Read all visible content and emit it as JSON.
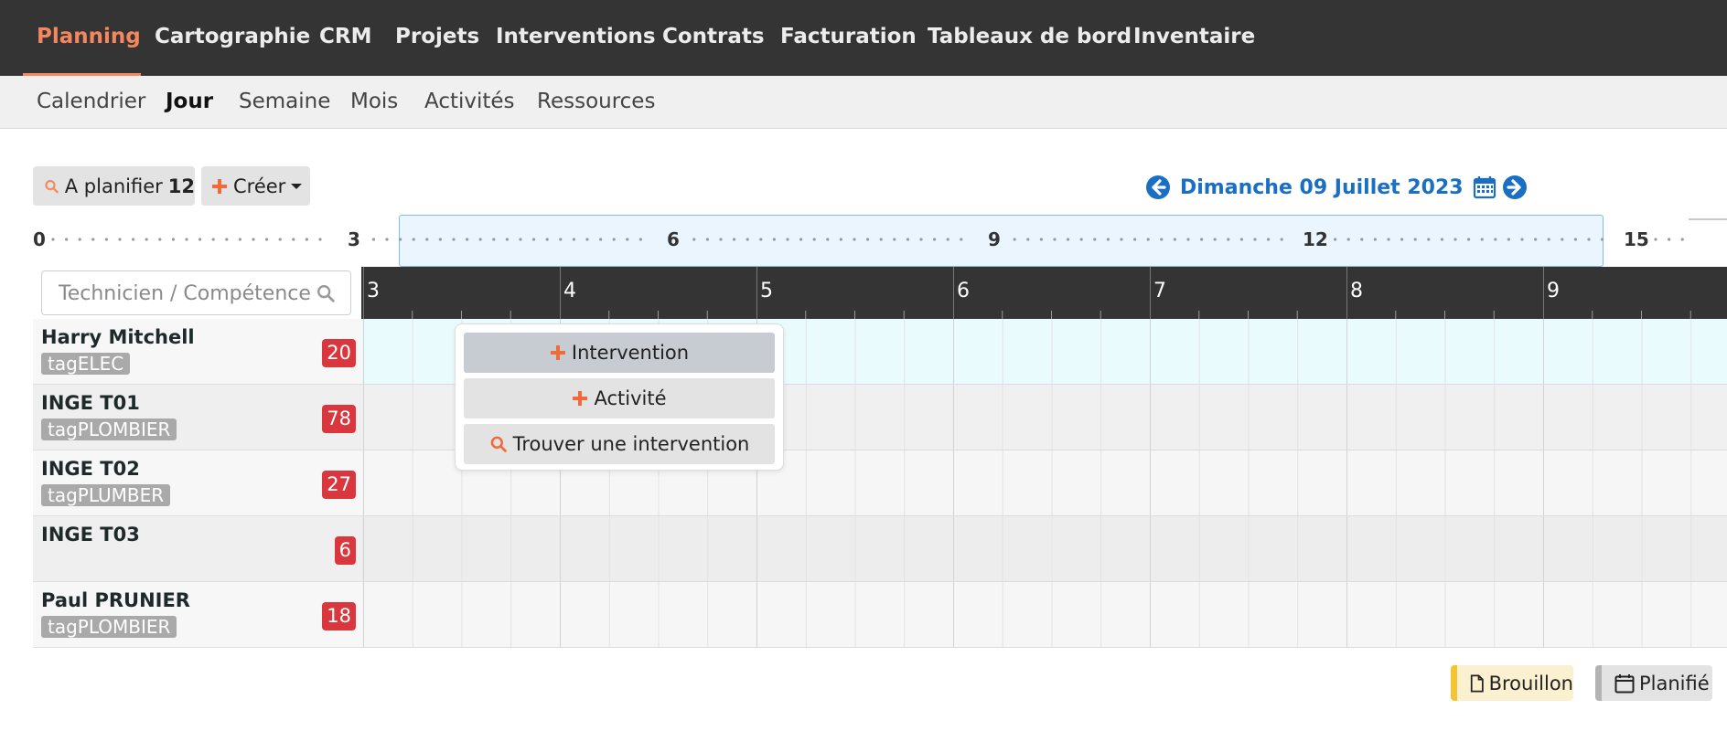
{
  "top_nav": {
    "items": [
      {
        "label": "Planning",
        "active": true
      },
      {
        "label": "Cartographie"
      },
      {
        "label": "CRM"
      },
      {
        "label": "Projets"
      },
      {
        "label": "Interventions"
      },
      {
        "label": "Contrats"
      },
      {
        "label": "Facturation"
      },
      {
        "label": "Tableaux de bord"
      },
      {
        "label": "Inventaire"
      }
    ]
  },
  "sub_nav": {
    "items": [
      {
        "label": "Calendrier"
      },
      {
        "label": "Jour",
        "active": true
      },
      {
        "label": "Semaine"
      },
      {
        "label": "Mois"
      },
      {
        "label": "Activités"
      },
      {
        "label": "Ressources"
      }
    ]
  },
  "toolbar": {
    "to_plan_label": "A planifier",
    "to_plan_count": "12",
    "create_label": "Créer",
    "date": "Dimanche 09 Juillet 2023"
  },
  "hour_overview": {
    "labels": [
      "0",
      "3",
      "6",
      "9",
      "12",
      "15"
    ]
  },
  "search": {
    "placeholder": "Technicien / Compétence"
  },
  "timeline": {
    "hours": [
      "3",
      "4",
      "5",
      "6",
      "7",
      "8",
      "9"
    ]
  },
  "technicians": [
    {
      "name": "Harry Mitchell",
      "tag": "tagELEC",
      "count": "20"
    },
    {
      "name": "INGE T01",
      "tag": "tagPLOMBIER",
      "count": "78"
    },
    {
      "name": "INGE T02",
      "tag": "tagPLUMBER",
      "count": "27"
    },
    {
      "name": "INGE T03",
      "tag": "",
      "count": "6"
    },
    {
      "name": "Paul PRUNIER",
      "tag": "tagPLOMBIER",
      "count": "18"
    }
  ],
  "popup": {
    "intervention_label": "Intervention",
    "activity_label": "Activité",
    "find_label": "Trouver une intervention"
  },
  "legend": {
    "draft_label": "Brouillon",
    "planned_label": "Planifié"
  },
  "colors": {
    "accent": "#f4875d",
    "link_blue": "#1a6fc4",
    "badge_red": "#d9363e",
    "draft_yellow": "#f3c534",
    "nav_dark": "#343434",
    "highlight_row": "#eafbfd"
  }
}
